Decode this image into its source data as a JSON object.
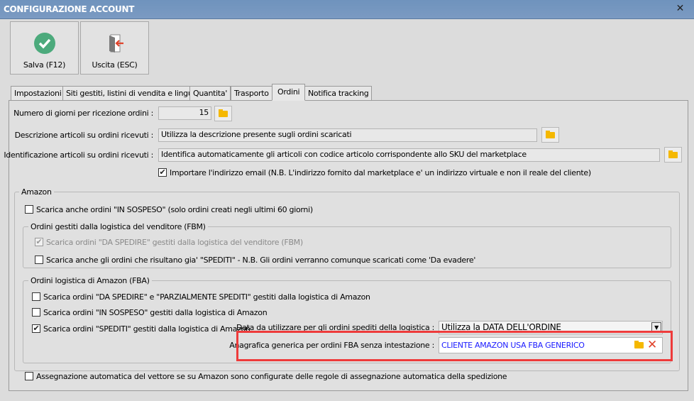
{
  "window": {
    "title": "CONFIGURAZIONE ACCOUNT",
    "close": "✕"
  },
  "toolbar": {
    "save_label": "Salva (F12)",
    "exit_label": "Uscita (ESC)"
  },
  "tabs": [
    {
      "label": "Impostazioni"
    },
    {
      "label": "Siti gestiti, listini di vendita e lingue"
    },
    {
      "label": "Quantita'"
    },
    {
      "label": "Trasporto"
    },
    {
      "label": "Ordini",
      "selected": true
    },
    {
      "label": "Notifica tracking"
    }
  ],
  "ordini": {
    "giorni_label": "Numero di giorni per ricezione ordini :",
    "giorni_value": "15",
    "descrizione_label": "Descrizione articoli su ordini ricevuti :",
    "descrizione_value": "Utilizza la descrizione presente sugli ordini scaricati",
    "identificazione_label": "Identificazione articoli su ordini ricevuti :",
    "identificazione_value": "Identifica automaticamente gli articoli con codice articolo corrispondente allo SKU del marketplace",
    "email_label": "Importare l'indirizzo email (N.B. L'indirizzo fornito dal marketplace e' un indirizzo virtuale e non il reale del cliente)",
    "email_checked": true
  },
  "amazon": {
    "title": "Amazon",
    "sospeso_label": "Scarica anche ordini \"IN SOSPESO\" (solo ordini creati negli ultimi 60 giorni)",
    "sospeso_checked": false,
    "fbm": {
      "title": "Ordini gestiti dalla logistica del venditore (FBM)",
      "da_spedire_label": "Scarica ordini \"DA SPEDIRE\" gestiti dalla logistica del venditore (FBM)",
      "da_spedire_checked": true,
      "spediti_label": "Scarica anche gli ordini che risultano gia' \"SPEDITI\" - N.B. Gli ordini verranno comunque scaricati come 'Da evadere'",
      "spediti_checked": false
    },
    "fba": {
      "title": "Ordini logistica di Amazon (FBA)",
      "da_spedire_label": "Scarica ordini \"DA SPEDIRE\" e \"PARZIALMENTE SPEDITI\" gestiti dalla logistica di Amazon",
      "da_spedire_checked": false,
      "sospeso_label": "Scarica ordini \"IN SOSPESO\" gestiti dalla logistica di Amazon",
      "sospeso_checked": false,
      "spediti_label": "Scarica ordini \"SPEDITI\" gestiti dalla logistica di Amazon",
      "spediti_checked": true,
      "data_label": "Data da utilizzare per gli ordini spediti della logistica :",
      "data_value": "Utilizza la DATA DELL'ORDINE",
      "anagrafica_label": "Anagrafica generica per ordini FBA senza intestazione :",
      "anagrafica_value": "CLIENTE AMAZON USA FBA GENERICO"
    },
    "vettore_label": "Assegnazione automatica del vettore se su Amazon sono configurate delle regole di assegnazione automatica della spedizione",
    "vettore_checked": false
  },
  "colors": {
    "highlight": "#ee3b3b",
    "link_value": "#1a1aff",
    "save_icon": "#4caa7c"
  }
}
